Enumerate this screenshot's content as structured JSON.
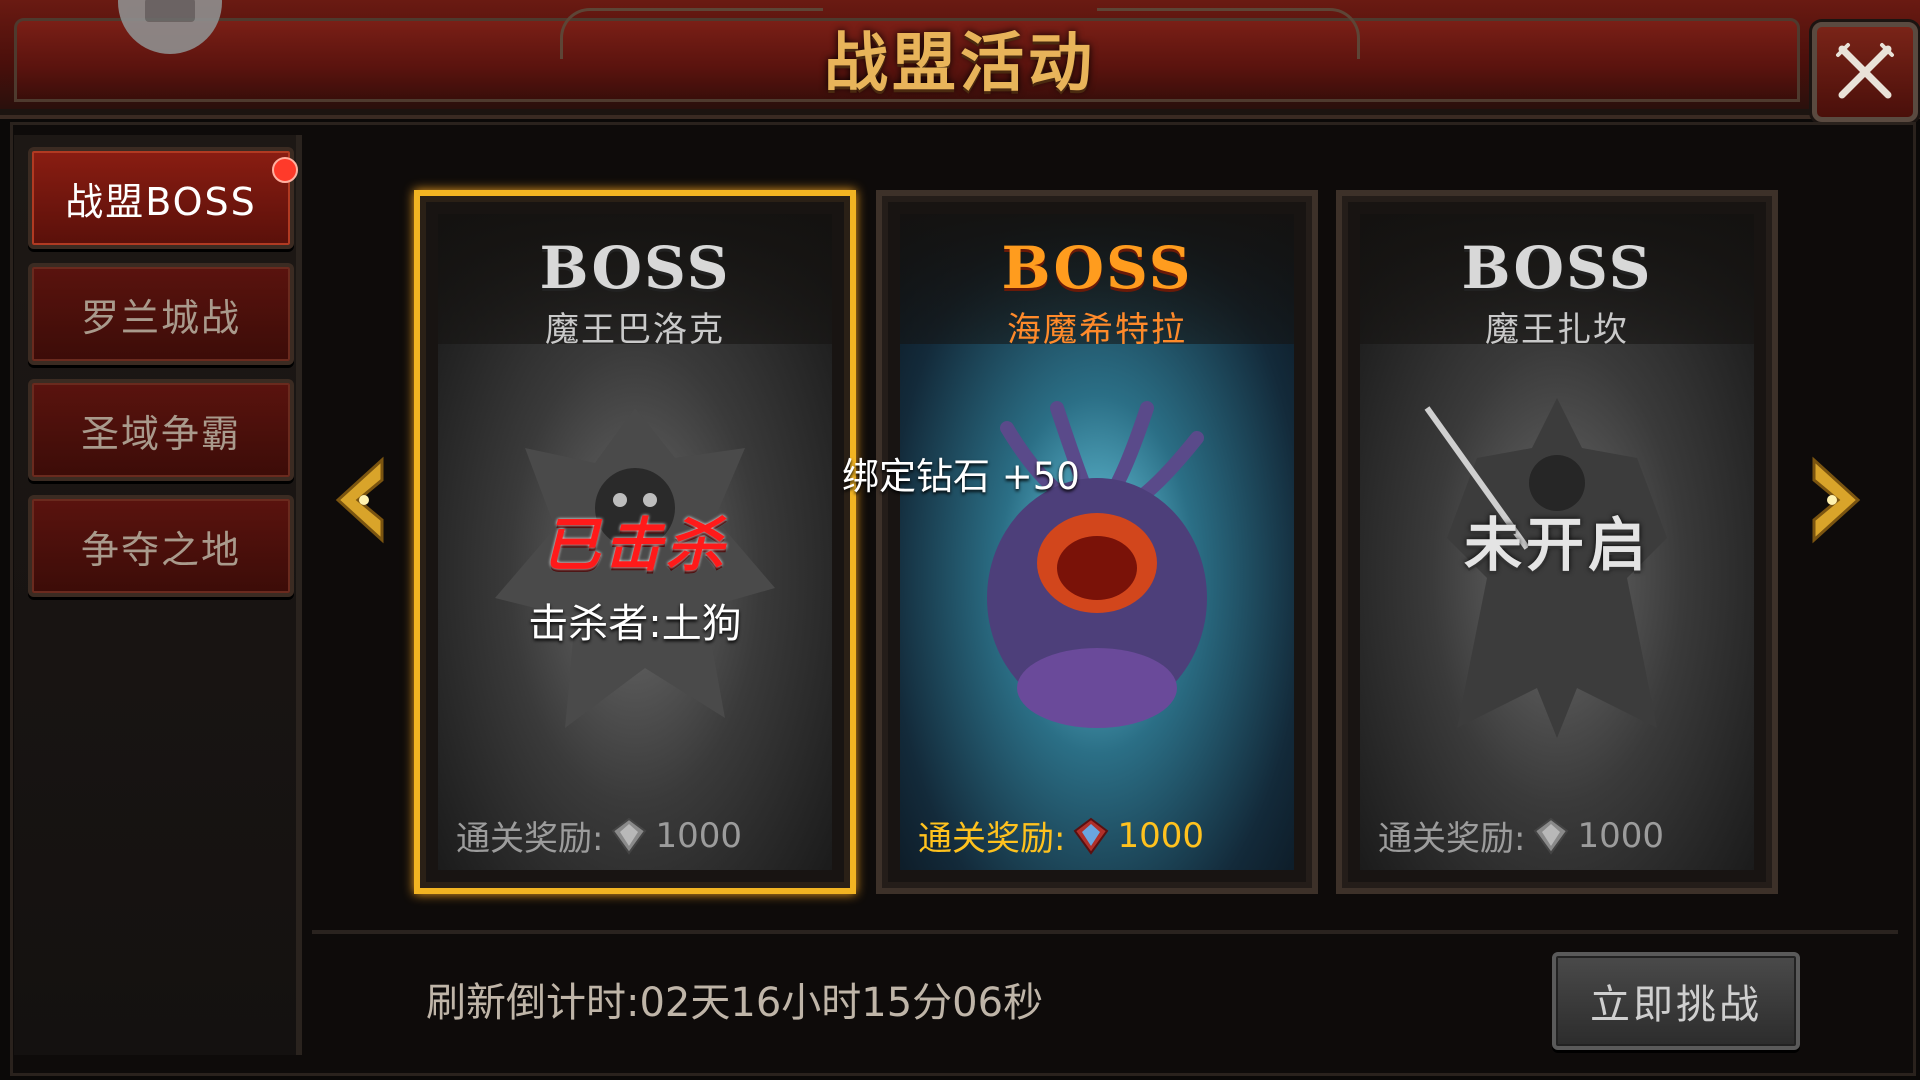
{
  "header": {
    "title": "战盟活动"
  },
  "sidebar": {
    "items": [
      {
        "label": "战盟BOSS",
        "active": true,
        "badge": true
      },
      {
        "label": "罗兰城战",
        "active": false
      },
      {
        "label": "圣域争霸",
        "active": false
      },
      {
        "label": "争夺之地",
        "active": false
      }
    ]
  },
  "cards": [
    {
      "boss_word": "BOSS",
      "name": "魔王巴洛克",
      "status": "已击杀",
      "killer": "击杀者:土狗",
      "reward_label": "通关奖励:",
      "reward_value": "1000",
      "selected": true
    },
    {
      "boss_word": "BOSS",
      "name": "海魔希特拉",
      "reward_label": "通关奖励:",
      "reward_value": "1000",
      "selected": false
    },
    {
      "boss_word": "BOSS",
      "name": "魔王扎坎",
      "status": "未开启",
      "reward_label": "通关奖励:",
      "reward_value": "1000",
      "selected": false
    }
  ],
  "floating_reward": "绑定钻石 +50",
  "footer": {
    "countdown": "刷新倒计时:02天16小时15分06秒",
    "challenge_button": "立即挑战"
  },
  "icons": {
    "close": "close-x-icon",
    "prev": "chevron-left-icon",
    "next": "chevron-right-icon",
    "gem": "diamond-gem-icon"
  },
  "colors": {
    "accent_gold": "#e8b45a",
    "selected_border": "#f2b422",
    "killed_red": "#ff1a1a",
    "active_tab": "#8a1d12"
  }
}
